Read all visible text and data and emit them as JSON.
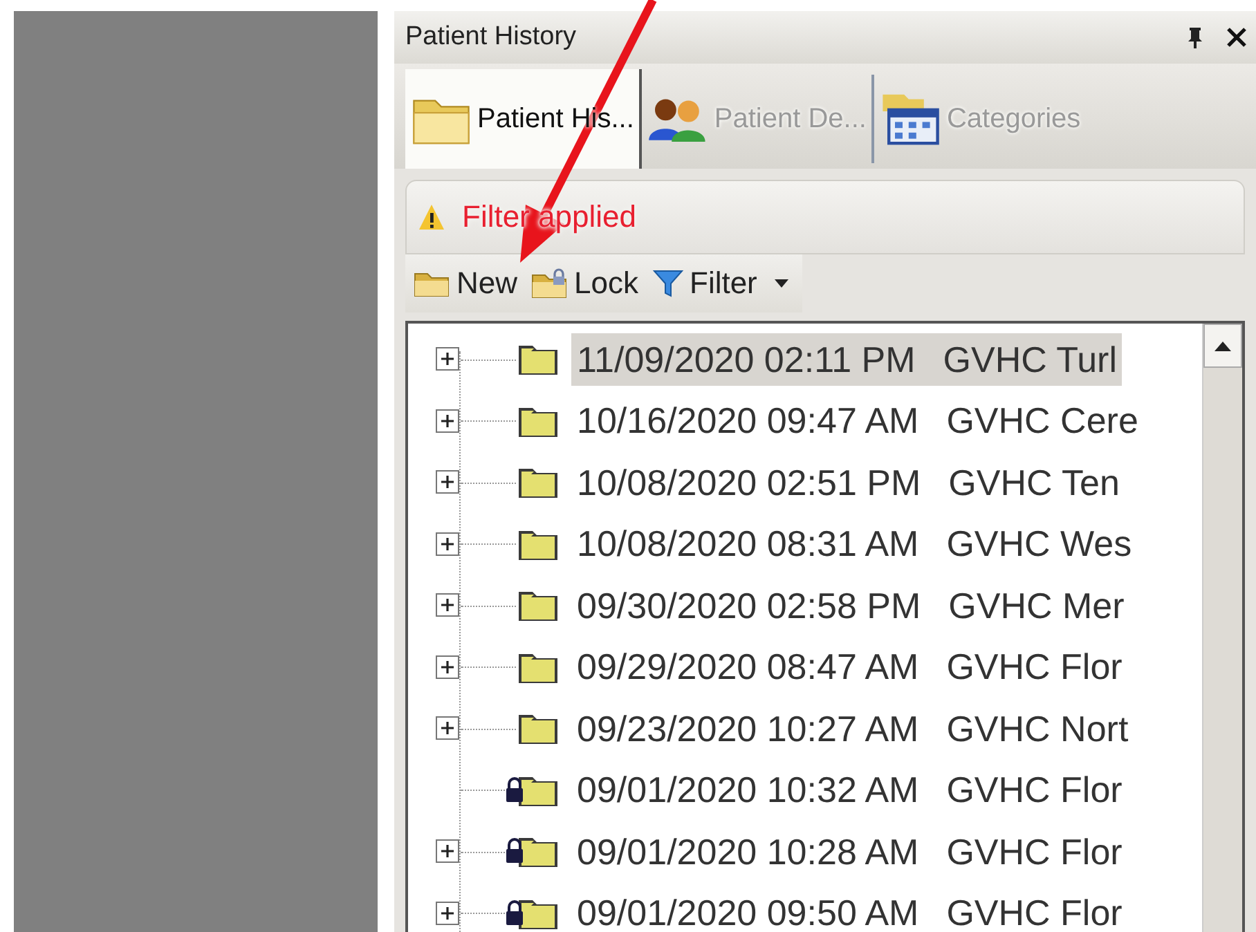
{
  "panel": {
    "title": "Patient History"
  },
  "tabs": [
    {
      "label": "Patient His...",
      "selected": true
    },
    {
      "label": "Patient De...",
      "selected": false
    },
    {
      "label": "Categories",
      "selected": false
    }
  ],
  "filter_notice": {
    "text": "Filter applied"
  },
  "toolbar": [
    {
      "label": "New",
      "kind": "new"
    },
    {
      "label": "Lock",
      "kind": "lock"
    },
    {
      "label": "Filter",
      "kind": "filter"
    }
  ],
  "tree": {
    "rows": [
      {
        "date": "11/09/2020 02:11 PM",
        "location": "GVHC Turl",
        "expandable": true,
        "locked": false,
        "selected": true
      },
      {
        "date": "10/16/2020 09:47 AM",
        "location": "GVHC Cere",
        "expandable": true,
        "locked": false,
        "selected": false
      },
      {
        "date": "10/08/2020 02:51 PM",
        "location": "GVHC Ten",
        "expandable": true,
        "locked": false,
        "selected": false
      },
      {
        "date": "10/08/2020 08:31 AM",
        "location": "GVHC Wes",
        "expandable": true,
        "locked": false,
        "selected": false
      },
      {
        "date": "09/30/2020 02:58 PM",
        "location": "GVHC Mer",
        "expandable": true,
        "locked": false,
        "selected": false
      },
      {
        "date": "09/29/2020 08:47 AM",
        "location": "GVHC Flor",
        "expandable": true,
        "locked": false,
        "selected": false
      },
      {
        "date": "09/23/2020 10:27 AM",
        "location": "GVHC Nort",
        "expandable": true,
        "locked": false,
        "selected": false
      },
      {
        "date": "09/01/2020 10:32 AM",
        "location": "GVHC Flor",
        "expandable": false,
        "locked": true,
        "selected": false
      },
      {
        "date": "09/01/2020 10:28 AM",
        "location": "GVHC Flor",
        "expandable": true,
        "locked": true,
        "selected": false
      },
      {
        "date": "09/01/2020 09:50 AM",
        "location": "GVHC Flor",
        "expandable": true,
        "locked": true,
        "selected": false
      }
    ]
  },
  "annotation": {
    "kind": "arrow"
  }
}
